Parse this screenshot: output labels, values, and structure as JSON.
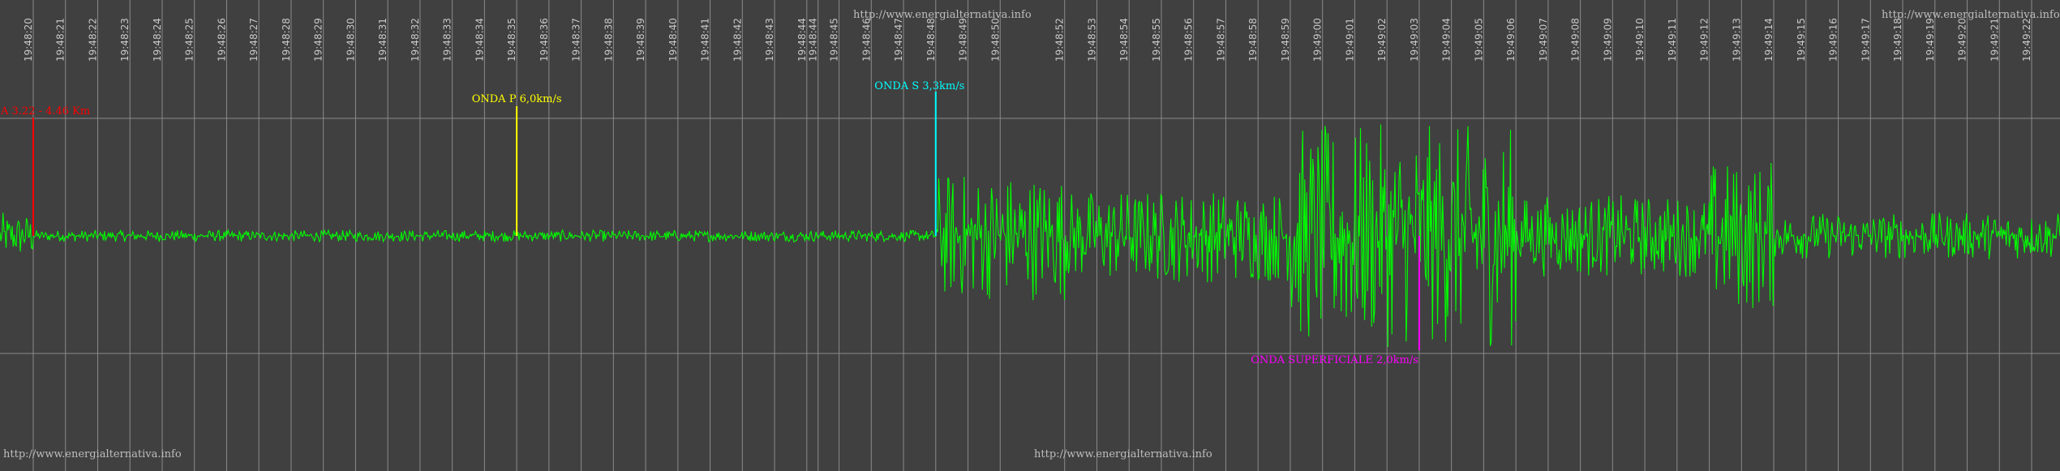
{
  "watermarks": {
    "top_center": "http://www.energialternativa.info",
    "top_right": "http://www.energialternativa.info",
    "bottom_left": "http://www.energialternativa.info",
    "bottom_center": "http://www.energialternativa.info"
  },
  "colors": {
    "background": "#404040",
    "grid": "#8a8a8a",
    "signal": "#00ff00",
    "tick_text": "#c8c8c8"
  },
  "chart_data": {
    "type": "line",
    "title": "",
    "xlabel": "",
    "ylabel": "",
    "grid": true,
    "time_ticks": [
      "19:48:20",
      "19:48:21",
      "19:48:22",
      "19:48:23",
      "19:48:24",
      "19:48:25",
      "19:48:26",
      "19:48:27",
      "19:48:28",
      "19:48:29",
      "19:48:30",
      "19:48:31",
      "19:48:32",
      "19:48:33",
      "19:48:34",
      "19:48:35",
      "19:48:36",
      "19:48:37",
      "19:48:38",
      "19:48:39",
      "19:48:40",
      "19:48:41",
      "19:48:42",
      "19:48:43",
      "19:48:44",
      "19:48:44",
      "19:48:45",
      "19:48:46",
      "19:48:47",
      "19:48:48",
      "19:48:49",
      "19:48:50",
      "19:48:52",
      "19:48:53",
      "19:48:54",
      "19:48:55",
      "19:48:56",
      "19:48:57",
      "19:48:58",
      "19:48:59",
      "19:49:00",
      "19:49:01",
      "19:49:02",
      "19:49:03",
      "19:49:04",
      "19:49:05",
      "19:49:06",
      "19:49:07",
      "19:49:08",
      "19:49:09",
      "19:49:10",
      "19:49:11",
      "19:49:12",
      "19:49:13",
      "19:49:14",
      "19:49:15",
      "19:49:16",
      "19:49:17",
      "19:49:18",
      "19:49:19",
      "19:49:20",
      "19:49:21",
      "19:49:22"
    ],
    "annotations": [
      {
        "label": "A 3.22 - 4.46 Km",
        "time": "19:48:20",
        "color": "#ff0000"
      },
      {
        "label": "ONDA P 6,0km/s",
        "time": "19:48:35",
        "color": "#ffff00"
      },
      {
        "label": "ONDA S 3,3km/s",
        "time": "19:48:48",
        "color": "#00ffff"
      },
      {
        "label": "ONDA SUPERFICIALE 2,0km/s",
        "time": "19:49:03",
        "color": "#ff00ff"
      }
    ],
    "series": [
      {
        "segments": [
          {
            "from": "19:48:20",
            "to": "19:48:48",
            "amplitude": 0.05
          },
          {
            "from": "19:48:48",
            "to": "19:48:52",
            "amplitude": 0.55
          },
          {
            "from": "19:48:52",
            "to": "19:48:59",
            "amplitude": 0.4
          },
          {
            "from": "19:48:59",
            "to": "19:49:06",
            "amplitude": 0.95
          },
          {
            "from": "19:49:06",
            "to": "19:49:12",
            "amplitude": 0.35
          },
          {
            "from": "19:49:12",
            "to": "19:49:14",
            "amplitude": 0.65
          },
          {
            "from": "19:49:14",
            "to": "19:49:22",
            "amplitude": 0.2
          }
        ]
      }
    ]
  }
}
